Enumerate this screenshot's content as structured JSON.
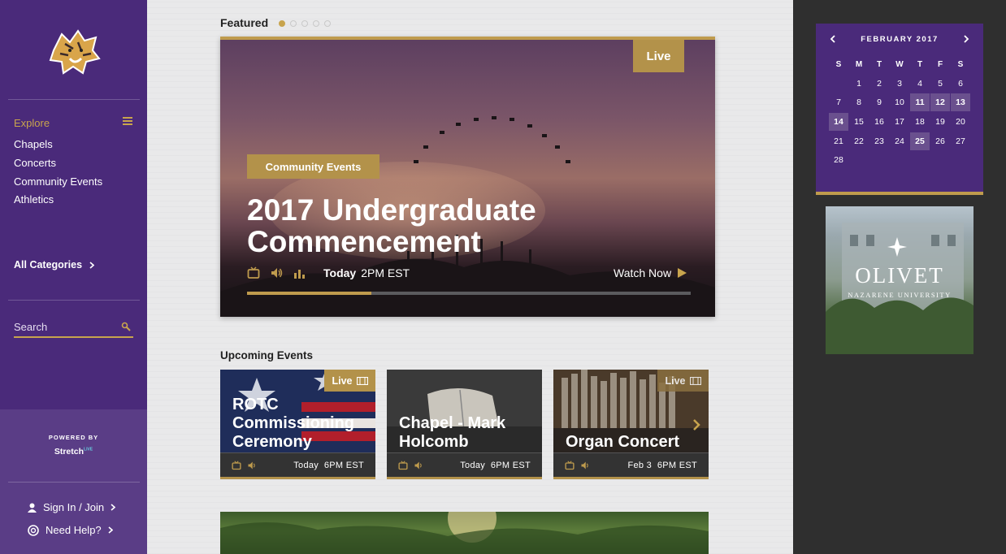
{
  "sidebar": {
    "explore_label": "Explore",
    "nav_items": [
      "Chapels",
      "Concerts",
      "Community Events",
      "Athletics"
    ],
    "all_categories": "All Categories",
    "search_placeholder": "Search",
    "powered_by": "POWERED BY",
    "brand": "Stretch",
    "brand_sup": "LIVE",
    "sign_in": "Sign In / Join",
    "need_help": "Need Help?",
    "accent_color": "#c8a44d",
    "bg_color": "#4a2a7a"
  },
  "featured": {
    "label": "Featured",
    "dots_active_index": 0,
    "dots_count": 5,
    "live_label": "Live",
    "category": "Community Events",
    "title": "2017 Undergraduate Commencement",
    "day": "Today",
    "time": "2PM EST",
    "watch_label": "Watch Now",
    "progress_fraction": 0.28,
    "icons": [
      "tv-icon",
      "audio-icon",
      "stats-icon"
    ]
  },
  "upcoming": {
    "label": "Upcoming Events",
    "events": [
      {
        "title": "ROTC Commissioning Ceremony",
        "live": "Live",
        "day": "Today",
        "time": "6PM EST"
      },
      {
        "title": "Chapel - Mark Holcomb",
        "live": "",
        "day": "Today",
        "time": "6PM EST"
      },
      {
        "title": "Organ Concert",
        "live": "Live",
        "day": "Feb 3",
        "time": "6PM EST"
      }
    ]
  },
  "calendar": {
    "month_label": "FEBRUARY 2017",
    "dow": [
      "S",
      "M",
      "T",
      "W",
      "T",
      "F",
      "S"
    ],
    "start_offset": 1,
    "days_in_month": 28,
    "highlighted": [
      11,
      12,
      13,
      14,
      25
    ],
    "bg_color": "#4a2a7a"
  },
  "school": {
    "name": "OLIVET",
    "subname": "NAZARENE UNIVERSITY"
  }
}
